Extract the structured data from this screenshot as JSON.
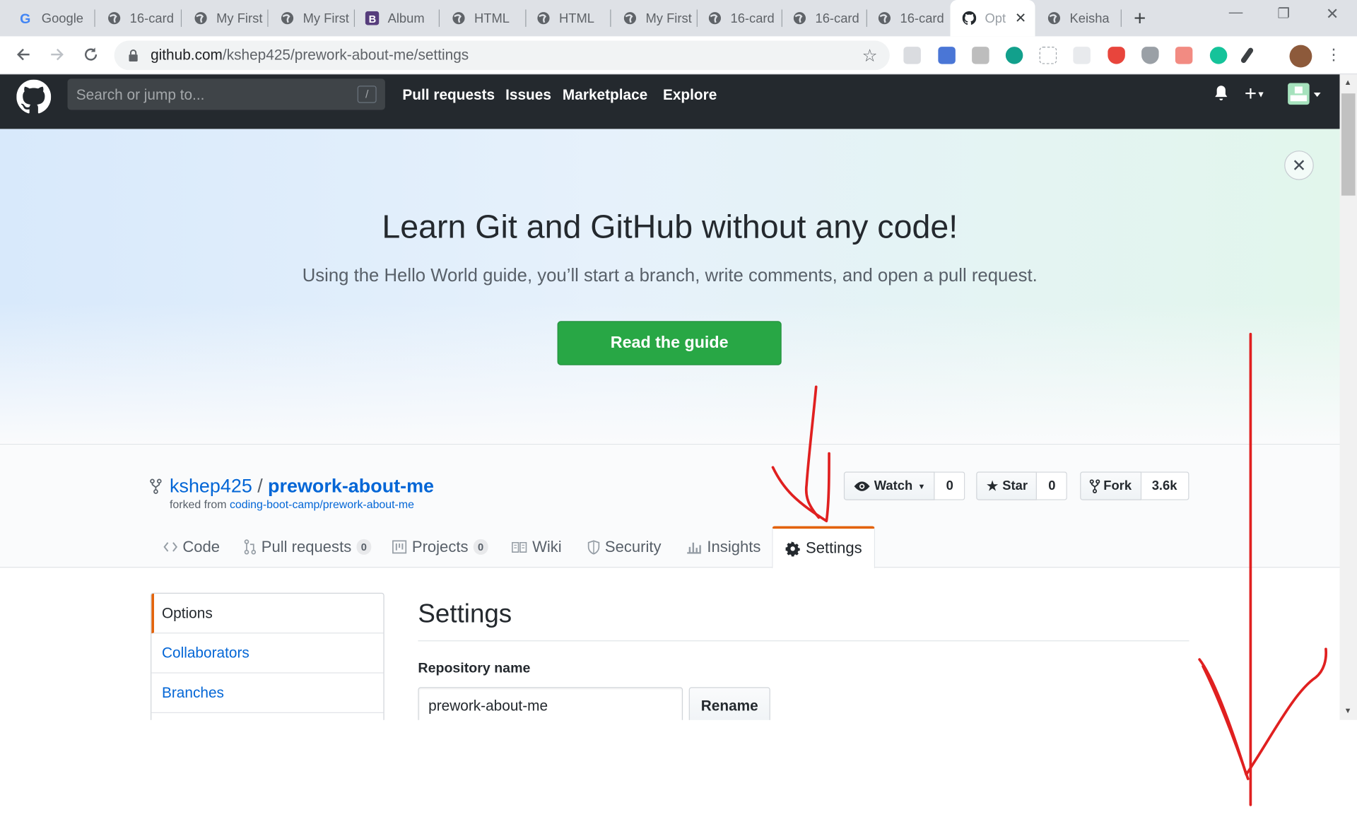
{
  "browser": {
    "tabs": [
      {
        "title": "Google",
        "icon": "google-icon"
      },
      {
        "title": "16-card",
        "icon": "globe-icon"
      },
      {
        "title": "My First",
        "icon": "globe-icon"
      },
      {
        "title": "My First",
        "icon": "globe-icon"
      },
      {
        "title": "Album",
        "icon": "bootstrap-icon"
      },
      {
        "title": "HTML",
        "icon": "globe-icon"
      },
      {
        "title": "HTML",
        "icon": "globe-icon"
      },
      {
        "title": "My First",
        "icon": "globe-icon"
      },
      {
        "title": "16-card",
        "icon": "globe-icon"
      },
      {
        "title": "16-card",
        "icon": "globe-icon"
      },
      {
        "title": "16-card",
        "icon": "globe-icon"
      },
      {
        "title": "Opt",
        "icon": "github-icon",
        "active": true
      },
      {
        "title": "Keisha",
        "icon": "globe-icon"
      }
    ],
    "url_domain": "github.com",
    "url_path": "/kshep425/prework-about-me/settings"
  },
  "github": {
    "search_placeholder": "Search or jump to...",
    "search_shortcut": "/",
    "nav": [
      "Pull requests",
      "Issues",
      "Marketplace",
      "Explore"
    ]
  },
  "hero": {
    "title": "Learn Git and GitHub without any code!",
    "subtitle": "Using the Hello World guide, you’ll start a branch, write comments, and open a pull request.",
    "button": "Read the guide",
    "accent": "#28a745"
  },
  "repo": {
    "owner": "kshep425",
    "separator": "/",
    "name": "prework-about-me",
    "forked_label": "forked from",
    "forked_from": "coding-boot-camp/prework-about-me",
    "watch_label": "Watch",
    "watch_count": "0",
    "star_label": "Star",
    "star_count": "0",
    "fork_label": "Fork",
    "fork_count": "3.6k",
    "tabs": [
      {
        "label": "Code",
        "icon": "code-icon"
      },
      {
        "label": "Pull requests",
        "icon": "pull-request-icon",
        "count": "0"
      },
      {
        "label": "Projects",
        "icon": "project-icon",
        "count": "0"
      },
      {
        "label": "Wiki",
        "icon": "book-icon"
      },
      {
        "label": "Security",
        "icon": "shield-icon"
      },
      {
        "label": "Insights",
        "icon": "graph-icon"
      },
      {
        "label": "Settings",
        "icon": "gear-icon",
        "selected": true
      }
    ],
    "tab_accent": "#e36209"
  },
  "settings": {
    "menu": [
      "Options",
      "Collaborators",
      "Branches"
    ],
    "heading": "Settings",
    "repo_name_label": "Repository name",
    "repo_name_value": "prework-about-me",
    "rename_button": "Rename"
  },
  "annotation_color": "#e02020"
}
